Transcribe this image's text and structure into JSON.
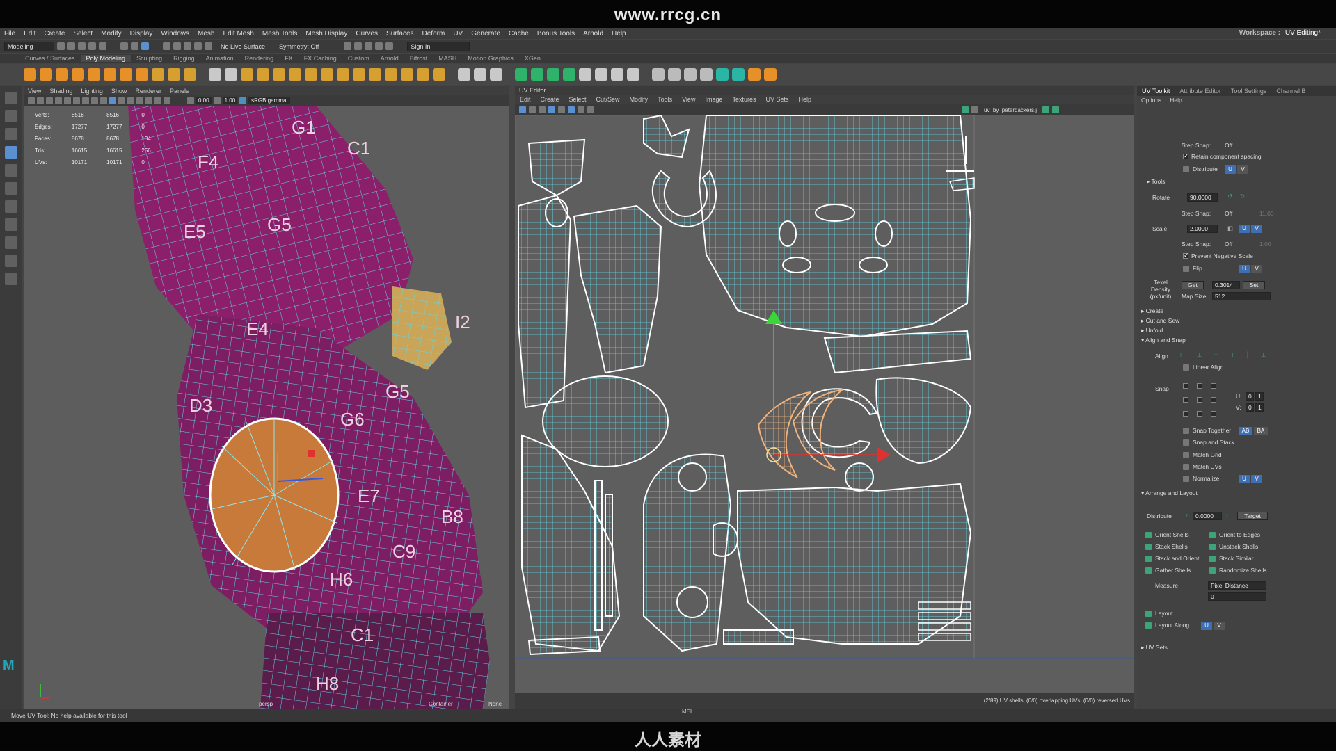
{
  "watermark": {
    "site": "www.rrcg.cn",
    "logo": "人人素材"
  },
  "menubar": {
    "items": [
      "File",
      "Edit",
      "Create",
      "Select",
      "Modify",
      "Display",
      "Windows",
      "Mesh",
      "Edit Mesh",
      "Mesh Tools",
      "Mesh Display",
      "Curves",
      "Surfaces",
      "Deform",
      "UV",
      "Generate",
      "Cache",
      "Bonus Tools",
      "Arnold",
      "Help"
    ],
    "workspace_label": "Workspace :",
    "workspace_value": "UV Editing*"
  },
  "statusline": {
    "mode": "Modeling",
    "live_surface": "No Live Surface",
    "symmetry": "Symmetry: Off",
    "sign_in": "Sign In"
  },
  "shelf_tabs": {
    "items": [
      "Curves / Surfaces",
      "Poly Modeling",
      "Sculpting",
      "Rigging",
      "Animation",
      "Rendering",
      "FX",
      "FX Caching",
      "Custom",
      "Arnold",
      "Bifrost",
      "MASH",
      "Motion Graphics",
      "XGen"
    ],
    "active": "Poly Modeling"
  },
  "viewport": {
    "menu": [
      "View",
      "Shading",
      "Lighting",
      "Show",
      "Renderer",
      "Panels"
    ],
    "exposure": "0.00",
    "gamma": "1.00",
    "colorspace": "sRGB gamma",
    "hud": [
      {
        "label": "Verts:",
        "a": "8516",
        "b": "8516",
        "c": "0"
      },
      {
        "label": "Edges:",
        "a": "17277",
        "b": "17277",
        "c": "0"
      },
      {
        "label": "Faces:",
        "a": "8678",
        "b": "8678",
        "c": "134"
      },
      {
        "label": "Tris:",
        "a": "16615",
        "b": "16615",
        "c": "256"
      },
      {
        "label": "UVs:",
        "a": "10171",
        "b": "10171",
        "c": "0"
      }
    ],
    "camera": "persp",
    "context": "Container",
    "none": "None",
    "checker_labels": [
      "F4",
      "G5",
      "G1",
      "E5",
      "E4",
      "D3",
      "C1",
      "G6",
      "E7",
      "G5",
      "C9",
      "H6",
      "B8",
      "C1",
      "H8",
      "I2"
    ]
  },
  "uv_editor": {
    "title": "UV Editor",
    "menu": [
      "Edit",
      "Create",
      "Select",
      "Cut/Sew",
      "Modify",
      "Tools",
      "View",
      "Image",
      "Textures",
      "UV Sets",
      "Help"
    ],
    "uvset": "uv_by_peterdackers.j",
    "status": "(2/89) UV shells, (0/0) overlapping UVs, (0/0) reversed UVs"
  },
  "uv_toolkit": {
    "tabs": [
      "UV Toolkit",
      "Attribute Editor",
      "Tool Settings",
      "Channel B"
    ],
    "menu": [
      "Options",
      "Help"
    ],
    "step_snap_label": "Step Snap:",
    "step_snap_value": "Off",
    "retain_spacing": "Retain component spacing",
    "distribute": "Distribute",
    "u": "U",
    "v": "V",
    "tools": "Tools",
    "rotate_label": "Rotate",
    "rotate_value": "90.0000",
    "rotate_step": "11.00",
    "scale_label": "Scale",
    "scale_value": "2.0000",
    "scale_step": "1.00",
    "prevent_negative": "Prevent Negative Scale",
    "flip": "Flip",
    "texel_label": "Texel Density (px/unit)",
    "get": "Get",
    "texel_value": "0.3014",
    "set": "Set",
    "map_size_label": "Map Size:",
    "map_size_value": "512",
    "sections": [
      "Create",
      "Cut and Sew",
      "Unfold",
      "Align and Snap"
    ],
    "align": "Align",
    "linear_align": "Linear Align",
    "snap": "Snap",
    "snap_u": "U:",
    "snap_v": "V:",
    "zero": "0",
    "one": "1",
    "snap_together": "Snap Together",
    "ab": "AB",
    "ba": "BA",
    "snap_and_stack": "Snap and Stack",
    "match_grid": "Match Grid",
    "match_uvs": "Match UVs",
    "normalize": "Normalize",
    "arrange": "Arrange and Layout",
    "distribute_value": "0.0000",
    "target": "Target",
    "left_buttons": [
      "Orient Shells",
      "Stack Shells",
      "Stack and Orient",
      "Gather Shells"
    ],
    "right_buttons": [
      "Orient to Edges",
      "Unstack Shells",
      "Stack Similar",
      "Randomize Shells"
    ],
    "measure": "Measure",
    "measure_mode": "Pixel Distance",
    "measure_value": "0",
    "layout": "Layout",
    "layout_along": "Layout Along",
    "uv_sets": "UV Sets"
  },
  "footer": {
    "help": "Move UV Tool: No help available for this tool",
    "mel": "MEL"
  },
  "colors": {
    "wire": "#5fd6e6",
    "mesh": "#8c1f6a",
    "selected": "#d98a4e",
    "accent": "#3e6fb2"
  }
}
